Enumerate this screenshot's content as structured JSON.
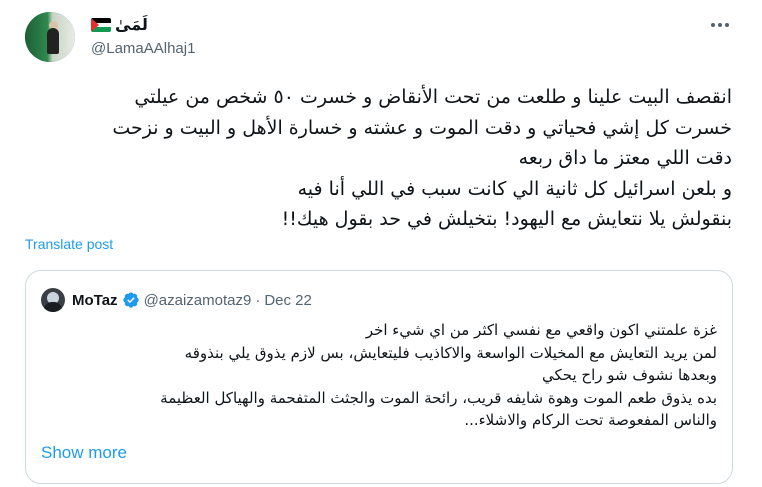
{
  "author": {
    "display_name": "لَمَىٰ",
    "handle": "@LamaAAlhaj1",
    "avatar_icon": "profile-photo",
    "flag_icon": "palestine-flag"
  },
  "tweet": {
    "lines": [
      "انقصف البيت علينا و طلعت من تحت الأنقاض و خسرت ٥٠ شخص من عيلتي",
      "خسرت كل إشي فحياتي و دقت الموت و عشته و خسارة الأهل و البيت و نزحت",
      "دقت اللي معتز ما داق ربعه",
      "و بلعن اسرائيل كل ثانية الي كانت سبب في اللي أنا فيه",
      "بنقولش يلا نتعايش مع اليهود! بتخيلش في حد بقول هيك!!"
    ],
    "translate_label": "Translate post"
  },
  "quote": {
    "display_name": "MoTaz",
    "verified": true,
    "verified_color": "#1d9bf0",
    "handle": "@azaizamotaz9",
    "separator": "·",
    "date": "Dec 22",
    "lines": [
      "غزة علمتني اكون واقعي مع نفسي اكثر من اي شيء اخر",
      "لمن يريد التعايش مع المخيلات الواسعة والاكاذيب فليتعايش، بس لازم يذوق يلي بنذوقه",
      "وبعدها نشوف شو راح يحكي",
      "بده يذوق طعم الموت وهوة شايفه قريب، رائحة الموت والجثث المتفحمة والهياكل العظيمة",
      "والناس المفعوصة تحت الركام والاشلاء..."
    ],
    "show_more_label": "Show more"
  },
  "colors": {
    "link": "#1d9bf0",
    "secondary_text": "#536471",
    "border": "#cfd9de"
  }
}
